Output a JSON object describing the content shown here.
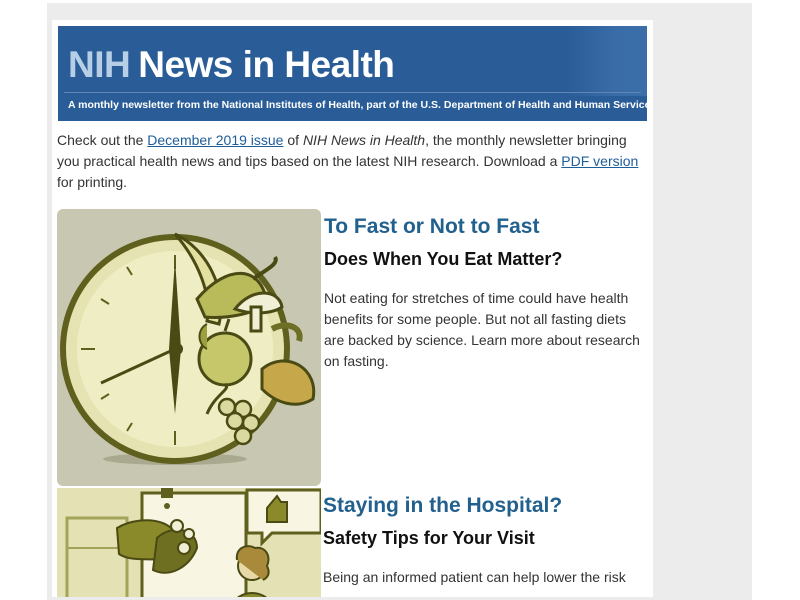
{
  "header": {
    "brand_nih": "NIH",
    "brand_title": "News in Health",
    "tagline": "A monthly newsletter from the National Institutes of Health, part of the U.S. Department of Health and Human Services"
  },
  "intro": {
    "lead": "Check out the ",
    "issue_link": "December 2019 issue",
    "after_link": " of ",
    "publication": "NIH News in Health",
    "middle": ", the monthly newsletter bringing you practical health news and tips based on the latest NIH research. Download a ",
    "pdf_link": "PDF version",
    "tail": " for printing."
  },
  "stories": [
    {
      "kicker": "To Fast or Not to Fast",
      "subhead": "Does When You Eat Matter?",
      "blurb": "Not eating for stretches of time could have health benefits for some people. But not all fasting diets are backed by science. Learn more about research on fasting.",
      "image_icon": "clock-food-illustration-icon"
    },
    {
      "kicker": "Staying in the Hospital?",
      "subhead": "Safety Tips for Your Visit",
      "blurb": "Being an informed patient can help lower the risk",
      "image_icon": "hospital-handwashing-illustration-icon"
    }
  ],
  "colors": {
    "masthead": "#2a5d97",
    "kicker": "#22608e",
    "link": "#1e5c9a",
    "illustration_bg": "#c9c9b3",
    "illustration_olive": "#8a8a2a"
  }
}
